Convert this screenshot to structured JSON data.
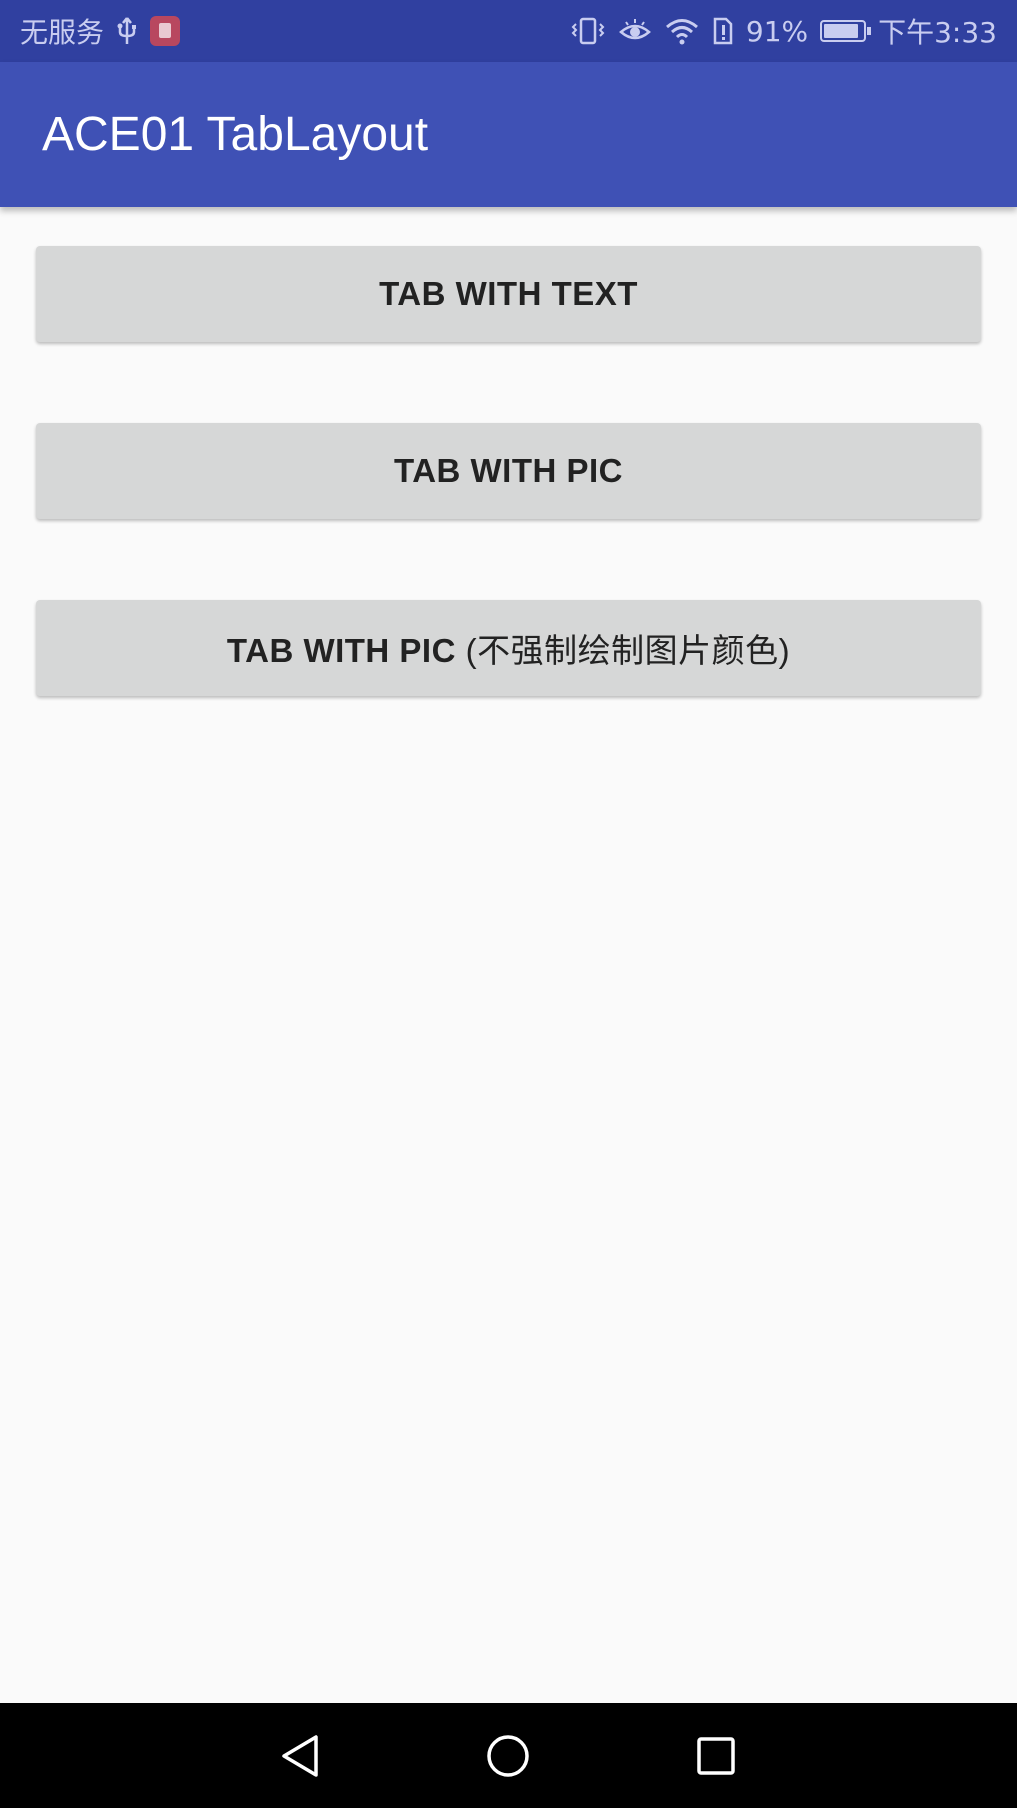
{
  "status_bar": {
    "carrier": "无服务",
    "usb_icon": "usb-icon",
    "app_icon": "app-notification-icon",
    "vibrate_icon": "vibrate-icon",
    "eye_icon": "eye-comfort-icon",
    "wifi_icon": "wifi-icon",
    "sim_alert_icon": "sim-alert-icon",
    "battery_percent": "91%",
    "battery_level": 0.91,
    "time": "下午3:33"
  },
  "app_bar": {
    "title": "ACE01 TabLayout",
    "color": "#3f51b5"
  },
  "buttons": [
    {
      "label": "TAB WITH TEXT"
    },
    {
      "label": "TAB WITH PIC"
    },
    {
      "label_latin": "TAB WITH PIC ",
      "label_cn": "(不强制绘制图片颜色)"
    }
  ],
  "nav_bar": {
    "back_icon": "back-triangle-icon",
    "home_icon": "home-circle-icon",
    "recents_icon": "recents-square-icon"
  }
}
